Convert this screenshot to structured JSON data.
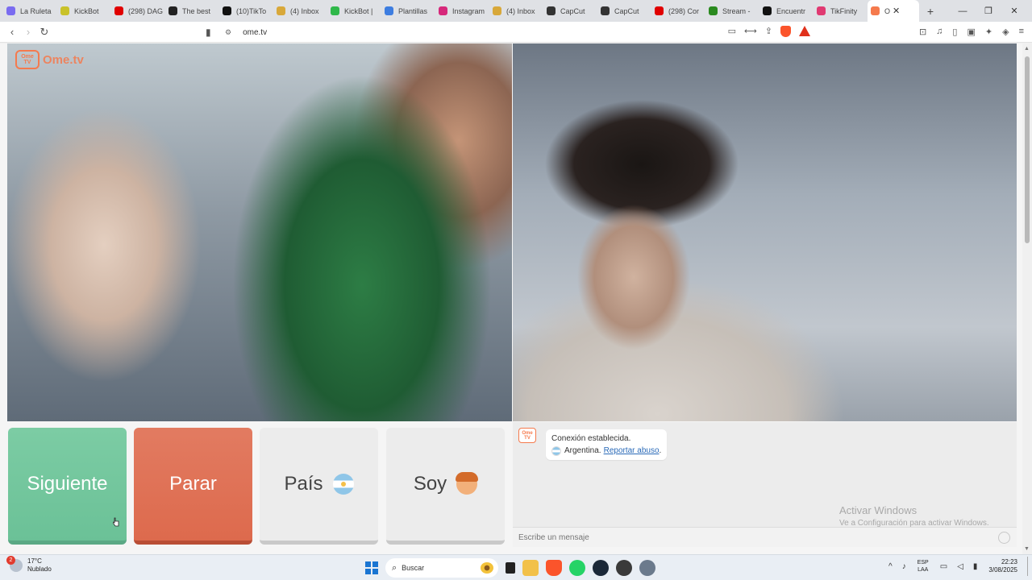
{
  "browser": {
    "tabs": [
      {
        "label": "La Ruleta",
        "color": "#7a6cf0"
      },
      {
        "label": "KickBot",
        "color": "#c9c22a"
      },
      {
        "label": "(298) DAG",
        "color": "#e00000"
      },
      {
        "label": "The best",
        "color": "#222222"
      },
      {
        "label": "(10)TikTo",
        "color": "#111111"
      },
      {
        "label": "(4) Inbox",
        "color": "#d8a83a"
      },
      {
        "label": "KickBot |",
        "color": "#2fb84a"
      },
      {
        "label": "Plantillas",
        "color": "#3d7de0"
      },
      {
        "label": "Instagram",
        "color": "#d6287b"
      },
      {
        "label": "(4) Inbox",
        "color": "#d8a83a"
      },
      {
        "label": "CapCut",
        "color": "#333333"
      },
      {
        "label": "CapCut",
        "color": "#333333"
      },
      {
        "label": "(298) Cor",
        "color": "#e00000"
      },
      {
        "label": "Stream -",
        "color": "#2a8a1f"
      },
      {
        "label": "Encuentr",
        "color": "#111111"
      },
      {
        "label": "TikFinity",
        "color": "#e03a72"
      }
    ],
    "active_tab": {
      "label": "O",
      "color": "#f57a4d",
      "close_glyph": "✕"
    },
    "new_tab_glyph": "+",
    "window_controls": [
      "—",
      "❐",
      "✕"
    ],
    "url": "ome.tv",
    "nav": {
      "back": "‹",
      "forward": "›",
      "reload": "↻"
    }
  },
  "page": {
    "logo": {
      "badge_top": "Ome",
      "badge_bottom": "TV",
      "text": "Ome.tv"
    },
    "buttons": {
      "next": "Siguiente",
      "stop": "Parar",
      "country": "País",
      "soy": "Soy"
    },
    "chat": {
      "system_badge_top": "Ome",
      "system_badge_bottom": "TV",
      "message_line1": "Conexión establecida.",
      "country": "Argentina.",
      "report_link": "Reportar abuso",
      "input_placeholder": "Escribe un mensaje",
      "watermark_title": "Activar Windows",
      "watermark_subtitle": "Ve a Configuración para activar Windows."
    }
  },
  "taskbar": {
    "weather_badge": "2",
    "temperature": "17°C",
    "condition": "Nublado",
    "search_placeholder": "Buscar",
    "tray_up": "^",
    "language_top": "ESP",
    "language_bottom": "LAA",
    "time": "22:23",
    "date": "3/08/2025"
  },
  "colors": {
    "next_button": "#6bc197",
    "stop_button": "#dd6a4d",
    "neutral_button": "#ececec",
    "brand_orange": "#f57a4d",
    "link_blue": "#2a6ab8"
  }
}
